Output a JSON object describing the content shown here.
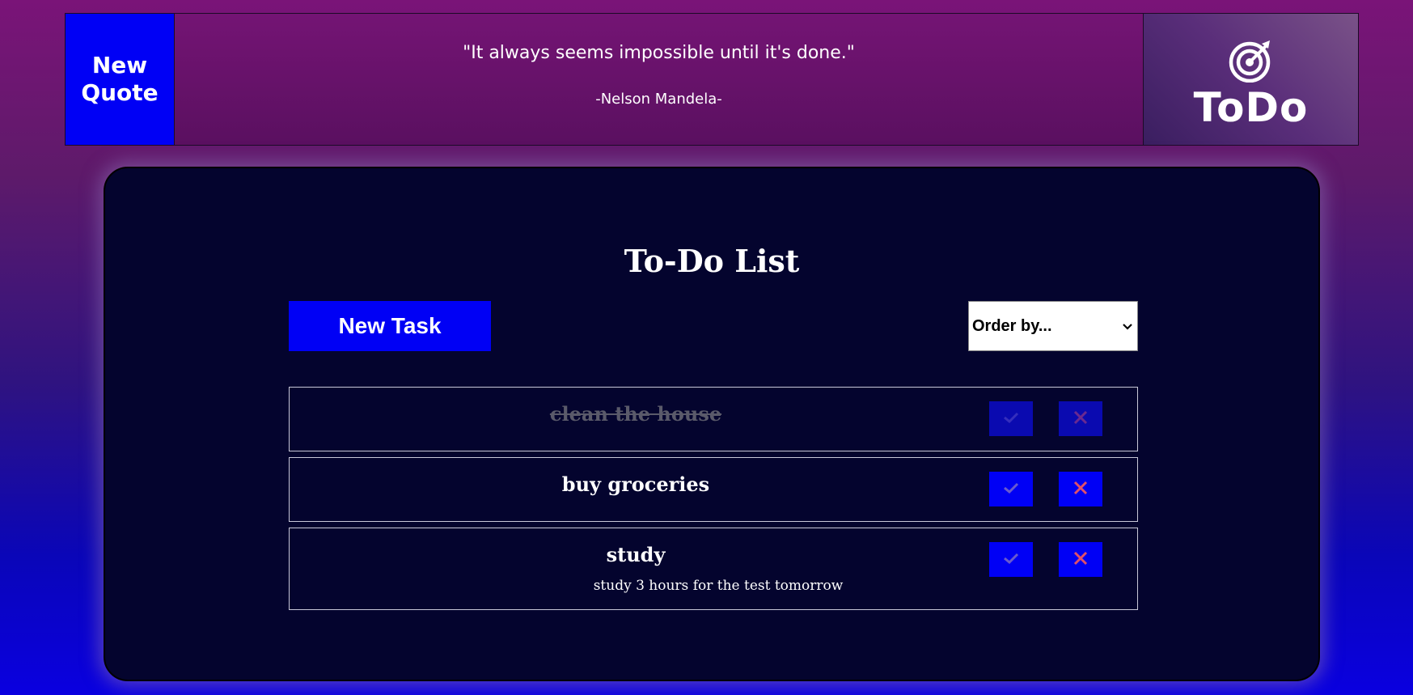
{
  "header": {
    "new_quote_label": "New Quote",
    "quote": "\"It always seems impossible until it's done.\"",
    "author": "-Nelson Mandela-",
    "logo_text": "ToDo",
    "logo_icon": "target-arrow-icon"
  },
  "main": {
    "title": "To-Do List",
    "new_task_label": "New Task",
    "order_select": {
      "value": "Order by..."
    },
    "tasks": [
      {
        "title": "clean the house",
        "description": "",
        "completed": true
      },
      {
        "title": "buy groceries",
        "description": "",
        "completed": false
      },
      {
        "title": "study",
        "description": "study 3 hours for the test tomorrow",
        "completed": false
      }
    ]
  },
  "colors": {
    "button_blue": "#0000f5",
    "card_bg": "#04042e",
    "check_icon": "#6a5acd",
    "delete_icon": "#e0506a"
  },
  "icons": {
    "complete": "check-icon",
    "delete": "x-icon",
    "select": "chevron-down-icon"
  }
}
